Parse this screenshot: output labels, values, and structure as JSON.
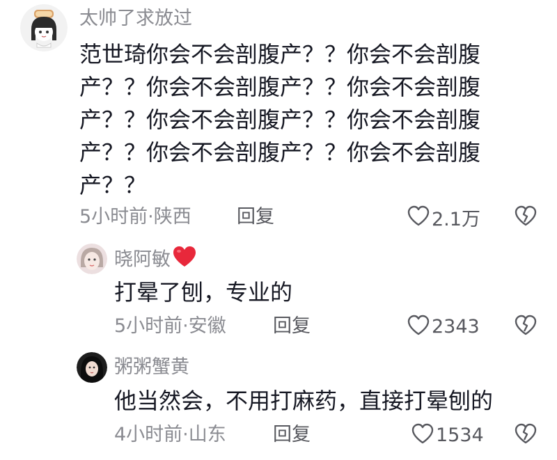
{
  "comments": [
    {
      "username": "太帅了求放过",
      "content": "范世琦你会不会剖腹产？？你会不会剖腹产？？你会不会剖腹产？？你会不会剖腹产？？你会不会剖腹产？？你会不会剖腹产？？你会不会剖腹产？？你会不会剖腹产？？",
      "time_location": "5小时前·陕西",
      "reply_label": "回复",
      "like_count": "2.1万"
    },
    {
      "username": "晓阿敏",
      "username_emoji": "❤️",
      "content": "打晕了刨，专业的",
      "time_location": "5小时前·安徽",
      "reply_label": "回复",
      "like_count": "2343"
    },
    {
      "username": "粥粥蟹黄",
      "content": "他当然会，不用打麻药，直接打晕刨的",
      "time_location": "4小时前·山东",
      "reply_label": "回复",
      "like_count": "1534"
    }
  ],
  "icons": {
    "like": "heart-outline-icon",
    "dislike": "broken-heart-icon"
  },
  "colors": {
    "text_primary": "#161823",
    "text_secondary": "#8a8b91",
    "icon": "#57585e",
    "heart_red": "#e8283b"
  }
}
